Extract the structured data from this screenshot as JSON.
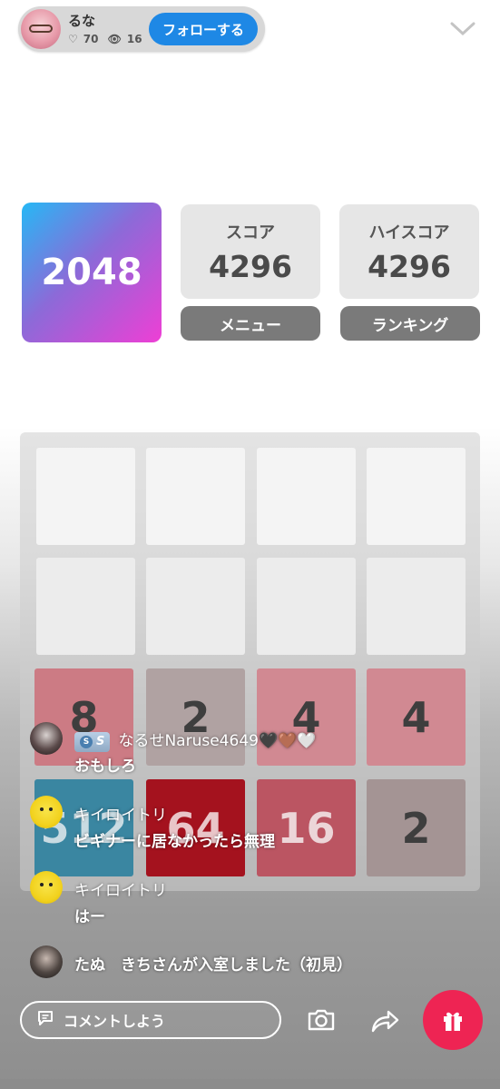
{
  "header": {
    "username": "るな",
    "likes": "70",
    "viewers": "16",
    "follow_label": "フォローする"
  },
  "game": {
    "logo": "2048",
    "score_label": "スコア",
    "score_value": "4296",
    "highscore_label": "ハイスコア",
    "highscore_value": "4296",
    "menu_label": "メニュー",
    "ranking_label": "ランキング",
    "tiles": [
      [
        "",
        "",
        "",
        ""
      ],
      [
        "",
        "",
        "",
        ""
      ],
      [
        "8",
        "2",
        "4",
        "4"
      ],
      [
        "512",
        "64",
        "16",
        "2"
      ]
    ]
  },
  "chat": [
    {
      "name": "なるせNaruse4649🖤🤎🤍",
      "message": "おもしろ",
      "badge": "S",
      "avatar": "goth-avatar"
    },
    {
      "name": "キイロイトリ",
      "message": "ビギナーに居なかったら無理",
      "avatar": "chick-avatar"
    },
    {
      "name": "キイロイトリ",
      "message": "はー",
      "avatar": "chick-avatar"
    }
  ],
  "system_message": "たぬ　きちさんが入室しました（初見）",
  "bottom": {
    "comment_placeholder": "コメントしよう"
  },
  "colors": {
    "follow_blue": "#1e88e5",
    "gift_red": "#ee2453",
    "button_gray": "#7a7a7a"
  }
}
